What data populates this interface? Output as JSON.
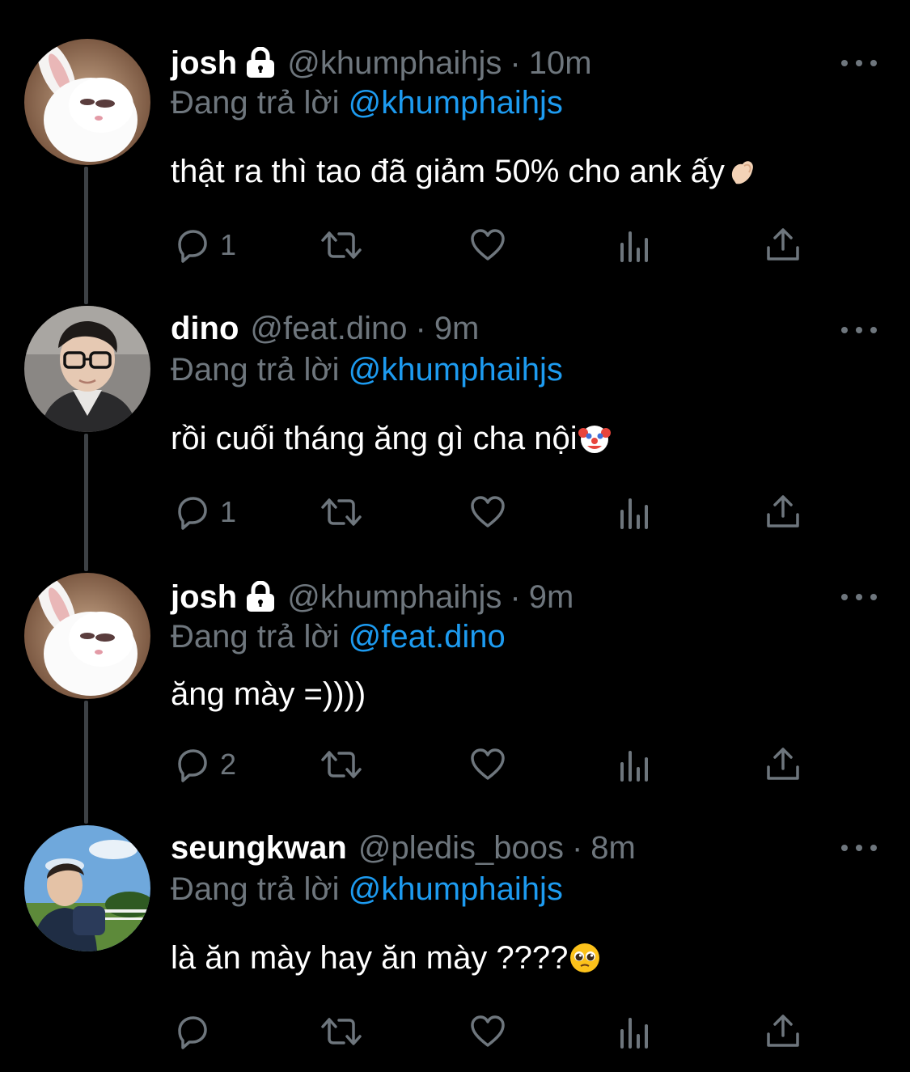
{
  "colors": {
    "background": "#000000",
    "text_primary": "#ffffff",
    "text_secondary": "#6e767d",
    "mention": "#1d9bf0",
    "thread_line": "#3d4145"
  },
  "reply_prefix": "Đang trả lời",
  "tweets": [
    {
      "name": "josh",
      "protected": true,
      "handle": "@khumphaihjs",
      "dot": "·",
      "time": "10m",
      "reply_to": "@khumphaihjs",
      "text": "thật ra thì tao đã giảm 50% cho ank ấy",
      "emoji": "pinching-hand-emoji",
      "reply_count": "1",
      "avatar": "white-rabbit-avatar"
    },
    {
      "name": "dino",
      "protected": false,
      "handle": "@feat.dino",
      "dot": "·",
      "time": "9m",
      "reply_to": "@khumphaihjs",
      "text": "rồi cuối tháng ăng gì cha nội",
      "emoji": "clown-face-emoji",
      "reply_count": "1",
      "avatar": "glasses-person-avatar"
    },
    {
      "name": "josh",
      "protected": true,
      "handle": "@khumphaihjs",
      "dot": "·",
      "time": "9m",
      "reply_to": "@feat.dino",
      "text": "ăng mày =))))",
      "emoji": "",
      "reply_count": "2",
      "avatar": "white-rabbit-avatar"
    },
    {
      "name": "seungkwan",
      "protected": false,
      "handle": "@pledis_boos",
      "dot": "·",
      "time": "8m",
      "reply_to": "@khumphaihjs",
      "text": "là ăn mày hay ăn mày ????",
      "emoji": "pleading-face-emoji",
      "reply_count": "",
      "avatar": "outdoor-person-avatar"
    }
  ]
}
